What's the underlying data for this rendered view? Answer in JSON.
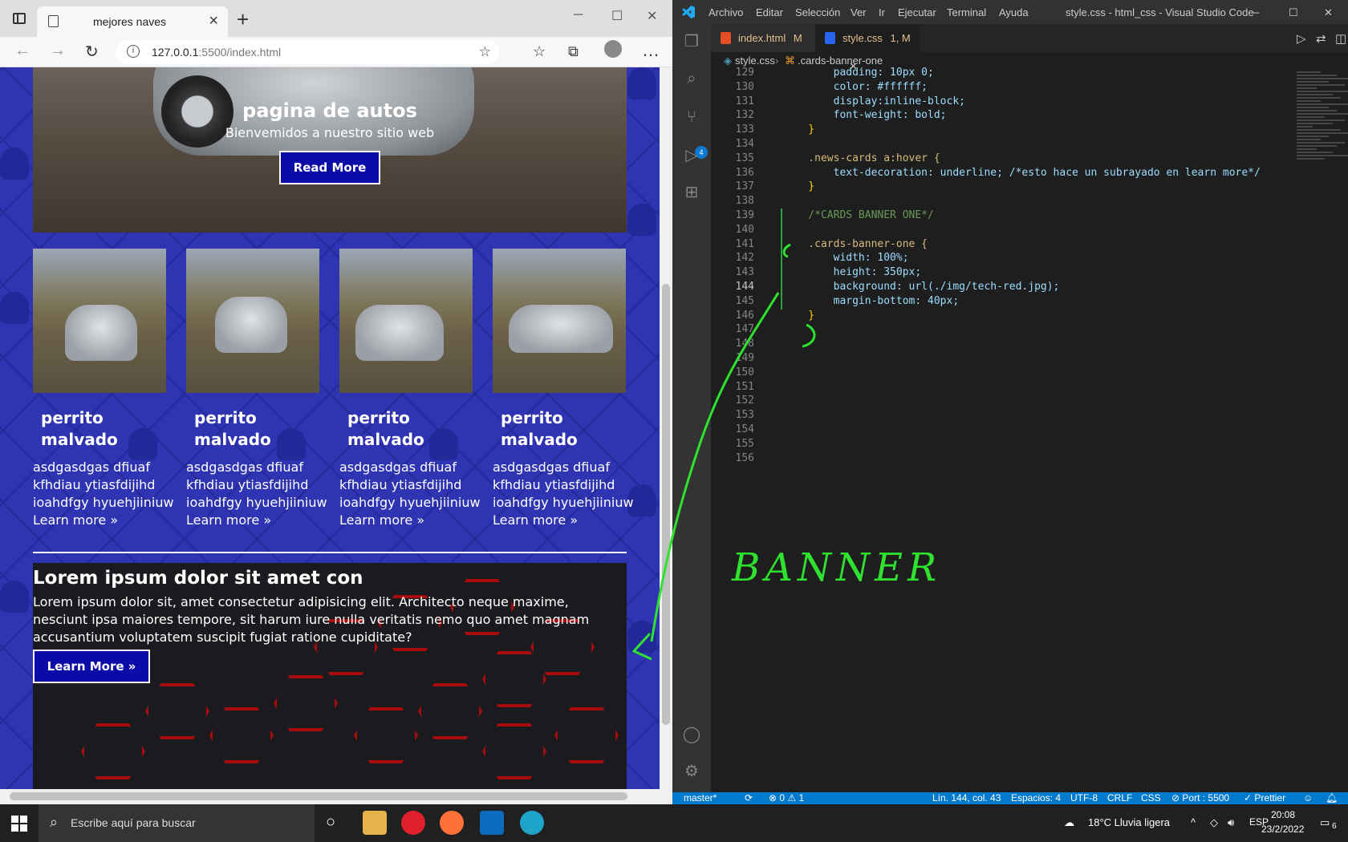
{
  "browser": {
    "tab_title": "mejores naves",
    "url_host": "127.0.0.1",
    "url_rest": ":5500/index.html",
    "hero": {
      "title": "pagina de autos",
      "subtitle": "Bienvemidos a nuestro sitio web",
      "button": "Read More"
    },
    "cards": [
      {
        "title": "perrito malvado",
        "text": "asdgasdgas dfiuaf kfhdiau ytiasfdijihd ioahdfgy hyuehjiiniuw",
        "link": "Learn more »"
      },
      {
        "title": "perrito malvado",
        "text": "asdgasdgas dfiuaf kfhdiau ytiasfdijihd ioahdfgy hyuehjiiniuw",
        "link": "Learn more »"
      },
      {
        "title": "perrito malvado",
        "text": "asdgasdgas dfiuaf kfhdiau ytiasfdijihd ioahdfgy hyuehjiiniuw",
        "link": "Learn more »"
      },
      {
        "title": "perrito malvado",
        "text": "asdgasdgas dfiuaf kfhdiau ytiasfdijihd ioahdfgy hyuehjiiniuw",
        "link": "Learn more »"
      }
    ],
    "banner": {
      "title": "Lorem ipsum dolor sit amet con",
      "text": "Lorem ipsum dolor sit, amet consectetur adipisicing elit. Architecto neque maxime, nesciunt ipsa maiores tempore, sit harum iure nulla veritatis nemo quo amet magnam accusantium voluptatem suscipit fugiat ratione cupiditate?",
      "button": "Learn More »"
    }
  },
  "vscode": {
    "menu": [
      "Archivo",
      "Editar",
      "Selección",
      "Ver",
      "Ir",
      "Ejecutar",
      "Terminal",
      "Ayuda"
    ],
    "window_title": "style.css - html_css - Visual Studio Code",
    "tabs": [
      {
        "label": "index.html",
        "mod": "M"
      },
      {
        "label": "style.css",
        "mod": "1, M"
      }
    ],
    "breadcrumb": {
      "file": "style.css",
      "symbol": ".cards-banner-one"
    },
    "scm_badge": "4",
    "lines": [
      {
        "n": "129",
        "code": "        padding: 10px 0;"
      },
      {
        "n": "130",
        "code": "        color: #ffffff;"
      },
      {
        "n": "131",
        "code": "        display:inline-block;"
      },
      {
        "n": "132",
        "code": "        font-weight: bold;"
      },
      {
        "n": "133",
        "code": "    }"
      },
      {
        "n": "134",
        "code": ""
      },
      {
        "n": "135",
        "code": "    .news-cards a:hover {"
      },
      {
        "n": "136",
        "code": "        text-decoration: underline; /*esto hace un subrayado en learn more*/"
      },
      {
        "n": "137",
        "code": "    }"
      },
      {
        "n": "138",
        "code": ""
      },
      {
        "n": "139",
        "code": "    /*CARDS BANNER ONE*/"
      },
      {
        "n": "140",
        "code": ""
      },
      {
        "n": "141",
        "code": "    .cards-banner-one {"
      },
      {
        "n": "142",
        "code": "        width: 100%;"
      },
      {
        "n": "143",
        "code": "        height: 350px;"
      },
      {
        "n": "144",
        "code": "        background: url(./img/tech-red.jpg);"
      },
      {
        "n": "145",
        "code": "        margin-bottom: 40px;"
      },
      {
        "n": "146",
        "code": "    }"
      },
      {
        "n": "147",
        "code": ""
      },
      {
        "n": "148",
        "code": ""
      },
      {
        "n": "149",
        "code": ""
      },
      {
        "n": "150",
        "code": ""
      },
      {
        "n": "151",
        "code": ""
      },
      {
        "n": "152",
        "code": ""
      },
      {
        "n": "153",
        "code": ""
      },
      {
        "n": "154",
        "code": ""
      },
      {
        "n": "155",
        "code": ""
      },
      {
        "n": "156",
        "code": ""
      }
    ],
    "status": {
      "branch": "master*",
      "problems": "⊗ 0 ⚠ 1",
      "position": "Lín. 144, col. 43",
      "spaces": "Espacios: 4",
      "encoding": "UTF-8",
      "eol": "CRLF",
      "lang": "CSS",
      "port": "⊘ Port : 5500",
      "prettier": "✓ Prettier"
    }
  },
  "annotation": "BANNER",
  "taskbar": {
    "search_placeholder": "Escribe aquí para buscar",
    "weather": "18°C  Lluvia ligera",
    "lang": "ESP",
    "time": "20:08",
    "date": "23/2/2022",
    "notif": "6"
  },
  "colors": {
    "accent": "#007acc",
    "page_bg": "#2e34b2",
    "button": "#0b0ba8",
    "annotation": "#2fe22f"
  }
}
